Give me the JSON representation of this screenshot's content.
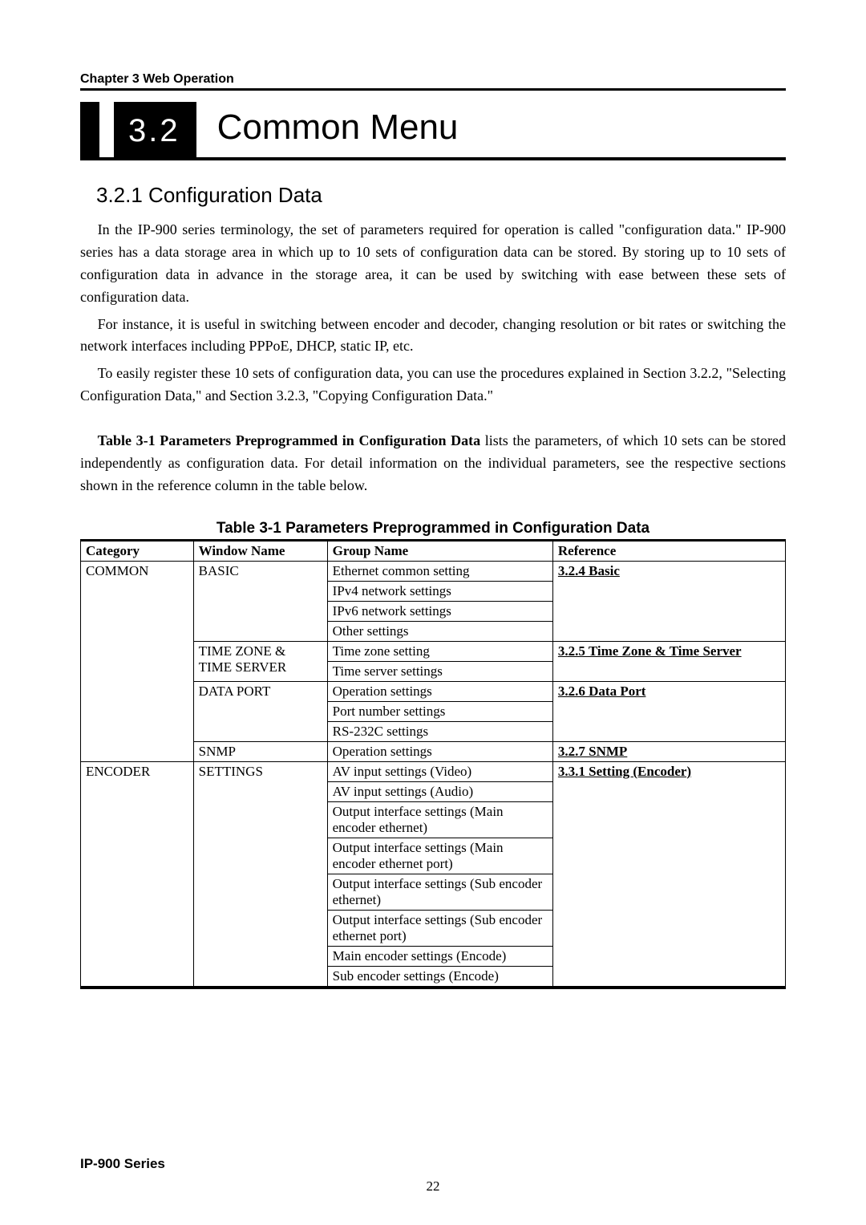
{
  "header": {
    "chapter": "Chapter 3  Web Operation"
  },
  "section": {
    "number": "3.2",
    "title": "Common Menu"
  },
  "subsection": {
    "title": "3.2.1  Configuration Data"
  },
  "paragraphs": {
    "p1": "In the IP-900 series terminology, the set of parameters required for operation is called \"configuration data.\" IP-900 series has a data storage area in which up to 10 sets of configuration data can be stored. By storing up to 10 sets of configuration data in advance in the storage area, it can be used by switching with ease between these sets of configuration data.",
    "p2": "For instance, it is useful in switching between encoder and decoder, changing resolution or bit rates or switching the network interfaces including PPPoE, DHCP, static IP, etc.",
    "p3": "To easily register these 10 sets of configuration data, you can use the procedures explained in Section 3.2.2, \"Selecting Configuration Data,\" and Section 3.2.3, \"Copying Configuration Data.\"",
    "p4_prefix": "Table 3-1  Parameters Preprogrammed in Configuration Data",
    "p4_rest": " lists the parameters, of which 10 sets can be stored independently as configuration data.  For detail information on the individual parameters, see the respective sections shown in the reference column in the table below."
  },
  "table": {
    "caption": "Table 3-1  Parameters Preprogrammed in Configuration Data",
    "headers": {
      "c1": "Category",
      "c2": "Window Name",
      "c3": "Group Name",
      "c4": "Reference"
    },
    "common": {
      "category": "COMMON",
      "basic": {
        "window": "BASIC",
        "groups": {
          "g1": "Ethernet common setting",
          "g2": "IPv4 network settings",
          "g3": "IPv6 network settings",
          "g4": "Other settings"
        },
        "reference": "3.2.4 Basic"
      },
      "timezone": {
        "window": "TIME ZONE & TIME SERVER",
        "groups": {
          "g1": "Time zone setting",
          "g2": "Time server settings"
        },
        "reference": "3.2.5 Time Zone & Time Server"
      },
      "dataport": {
        "window": "DATA PORT",
        "groups": {
          "g1": "Operation settings",
          "g2": "Port number settings",
          "g3": "RS-232C settings"
        },
        "reference": "3.2.6 Data Port"
      },
      "snmp": {
        "window": "SNMP",
        "groups": {
          "g1": "Operation settings"
        },
        "reference": "3.2.7 SNMP"
      }
    },
    "encoder": {
      "category": "ENCODER",
      "settings": {
        "window": "SETTINGS",
        "groups": {
          "g1": "AV input settings (Video)",
          "g2": "AV input settings (Audio)",
          "g3": "Output interface settings (Main encoder ethernet)",
          "g4": "Output interface settings (Main encoder ethernet port)",
          "g5": "Output interface settings (Sub encoder ethernet)",
          "g6": "Output interface settings (Sub encoder ethernet port)",
          "g7": "Main encoder settings (Encode)",
          "g8": "Sub encoder settings (Encode)"
        },
        "reference": "3.3.1 Setting (Encoder)"
      }
    }
  },
  "footer": {
    "series": "IP-900 Series",
    "page": "22"
  }
}
